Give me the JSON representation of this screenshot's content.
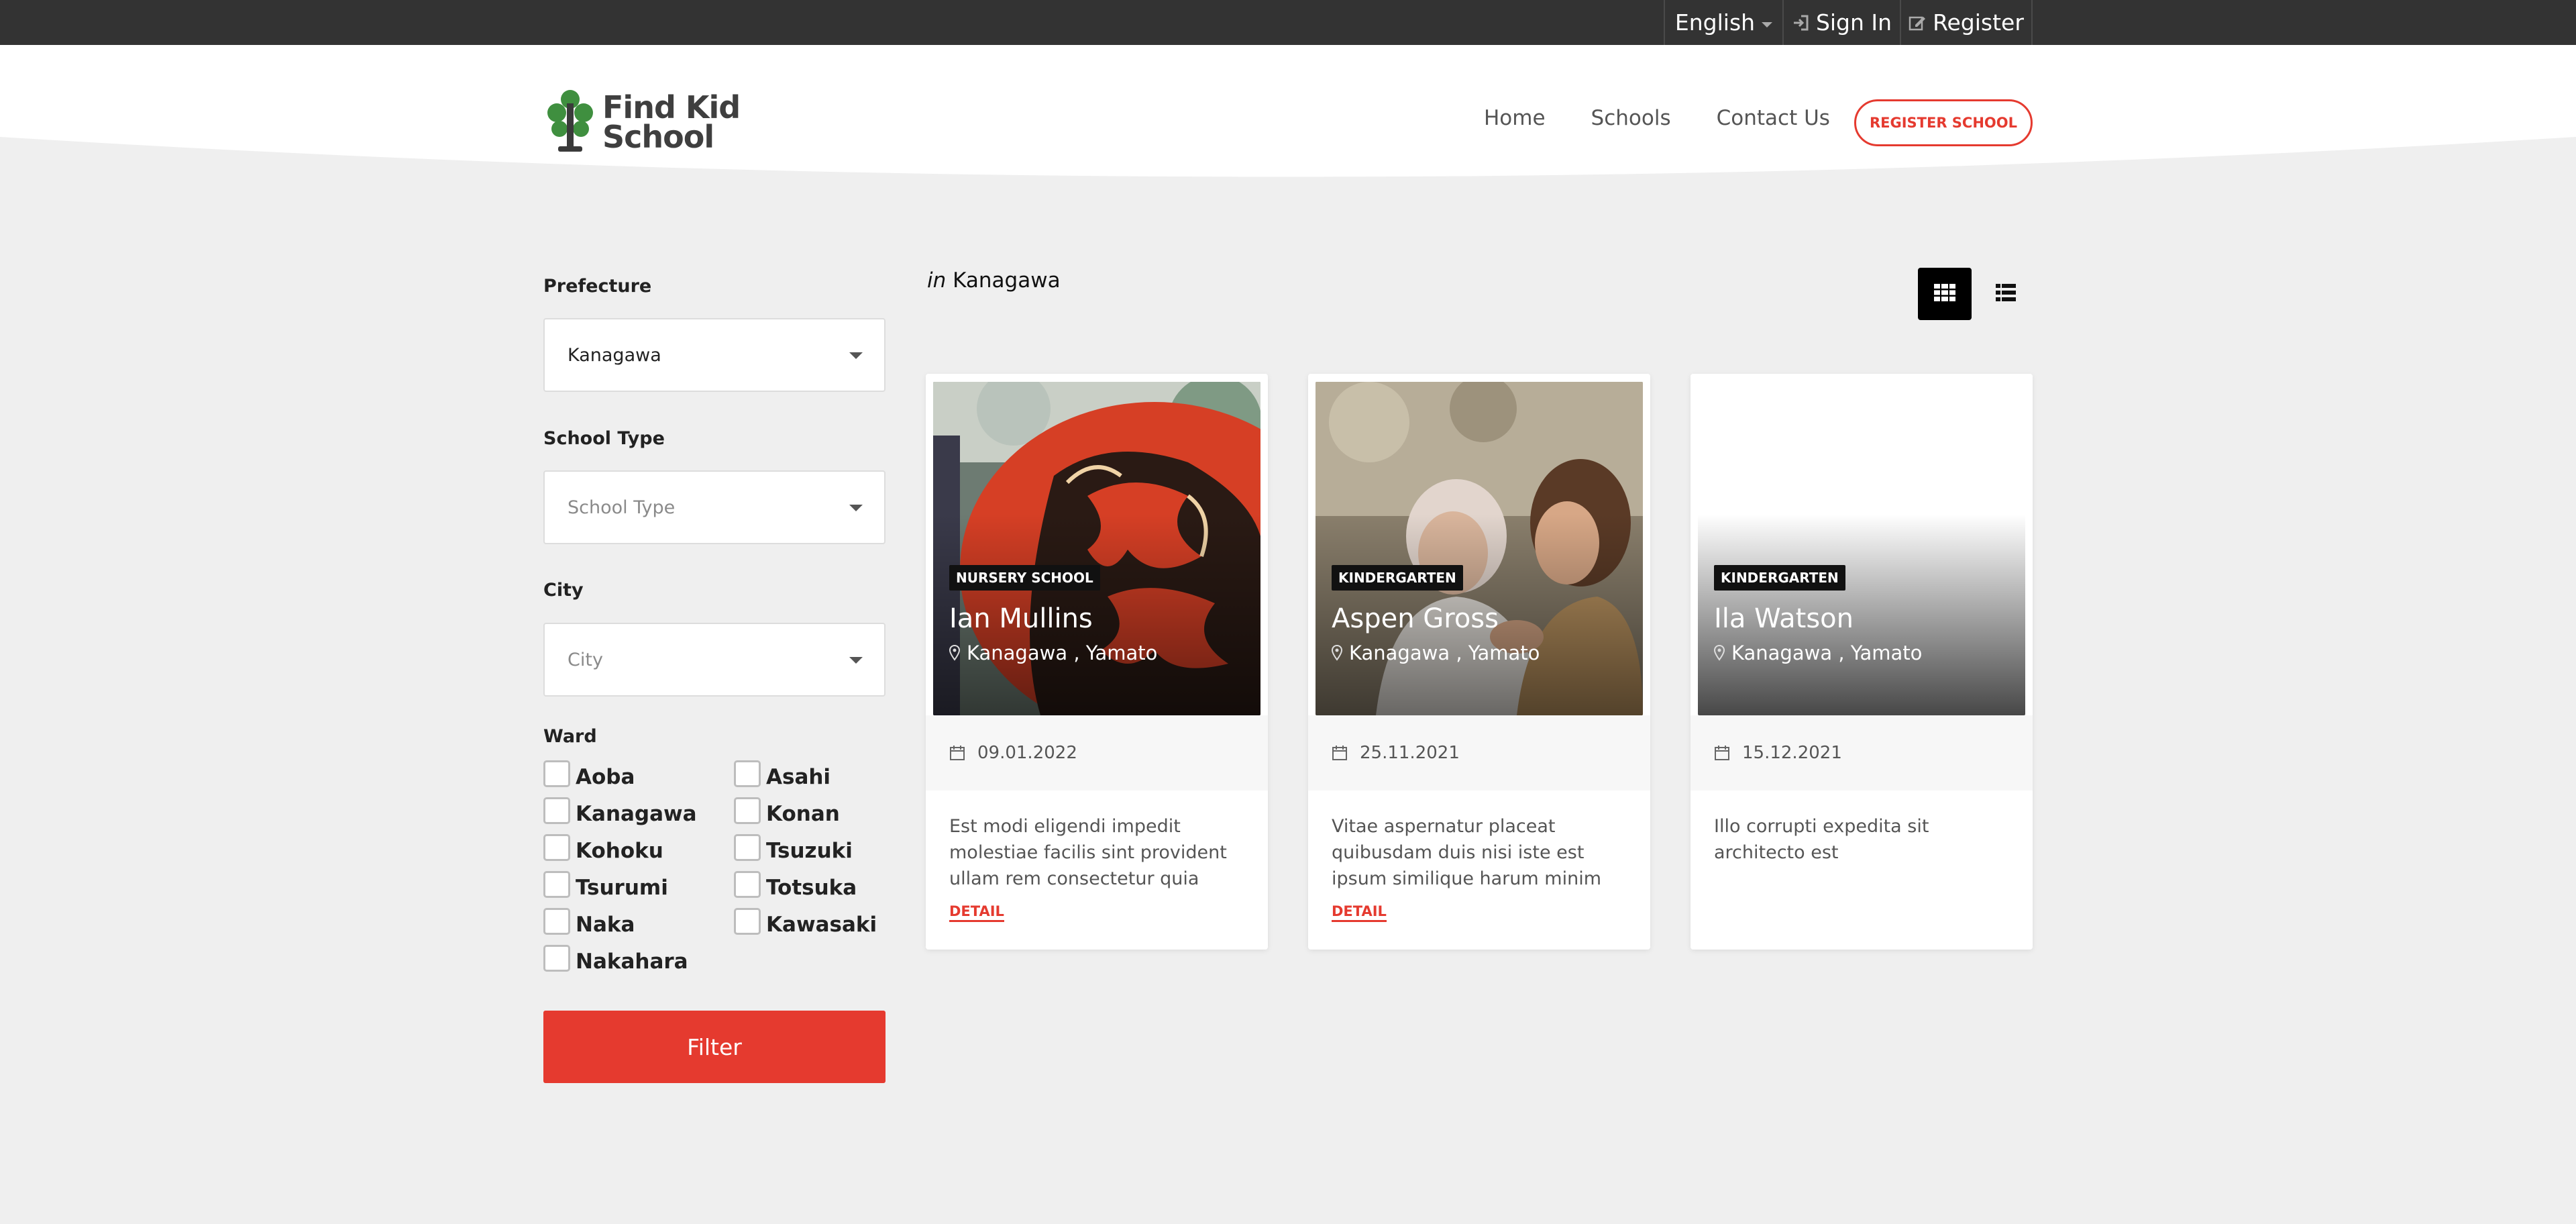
{
  "topbar": {
    "language": "English",
    "sign_in": "Sign In",
    "register": "Register"
  },
  "header": {
    "logo_line1": "Find Kid",
    "logo_line2": "School",
    "nav": [
      "Home",
      "Schools",
      "Contact Us"
    ],
    "register_school": "REGISTER SCHOOL"
  },
  "filters": {
    "prefecture_label": "Prefecture",
    "prefecture_value": "Kanagawa",
    "school_type_label": "School Type",
    "school_type_placeholder": "School Type",
    "city_label": "City",
    "city_placeholder": "City",
    "ward_label": "Ward",
    "wards": [
      "Aoba",
      "Asahi",
      "Kanagawa",
      "Konan",
      "Kohoku",
      "Tsuzuki",
      "Tsurumi",
      "Totsuka",
      "Naka",
      "Kawasaki",
      "Nakahara"
    ],
    "filter_button": "Filter"
  },
  "results": {
    "in_prefix": "in",
    "location": "Kanagawa",
    "cards": [
      {
        "type": "NURSERY SCHOOL",
        "name": "Ian Mullins",
        "location": "Kanagawa , Yamato",
        "date": "09.01.2022",
        "description": "Est modi eligendi impedit molestiae facilis sint provident ullam rem consectetur quia",
        "detail": "DETAIL"
      },
      {
        "type": "KINDERGARTEN",
        "name": "Aspen Gross",
        "location": "Kanagawa , Yamato",
        "date": "25.11.2021",
        "description": "Vitae aspernatur placeat quibusdam duis nisi iste est ipsum similique harum minim",
        "detail": "DETAIL"
      },
      {
        "type": "KINDERGARTEN",
        "name": "Ila Watson",
        "location": "Kanagawa , Yamato",
        "date": "15.12.2021",
        "description": "Illo corrupti expedita sit architecto est",
        "detail": ""
      }
    ]
  },
  "colors": {
    "accent": "#e53a2f",
    "topbar": "#333333",
    "background": "#efefef",
    "logo_green": "#3f8f3f"
  },
  "icons": [
    "sign-in-icon",
    "edit-icon",
    "grid-view-icon",
    "list-view-icon",
    "map-pin-icon",
    "calendar-icon",
    "tree-logo-icon"
  ]
}
